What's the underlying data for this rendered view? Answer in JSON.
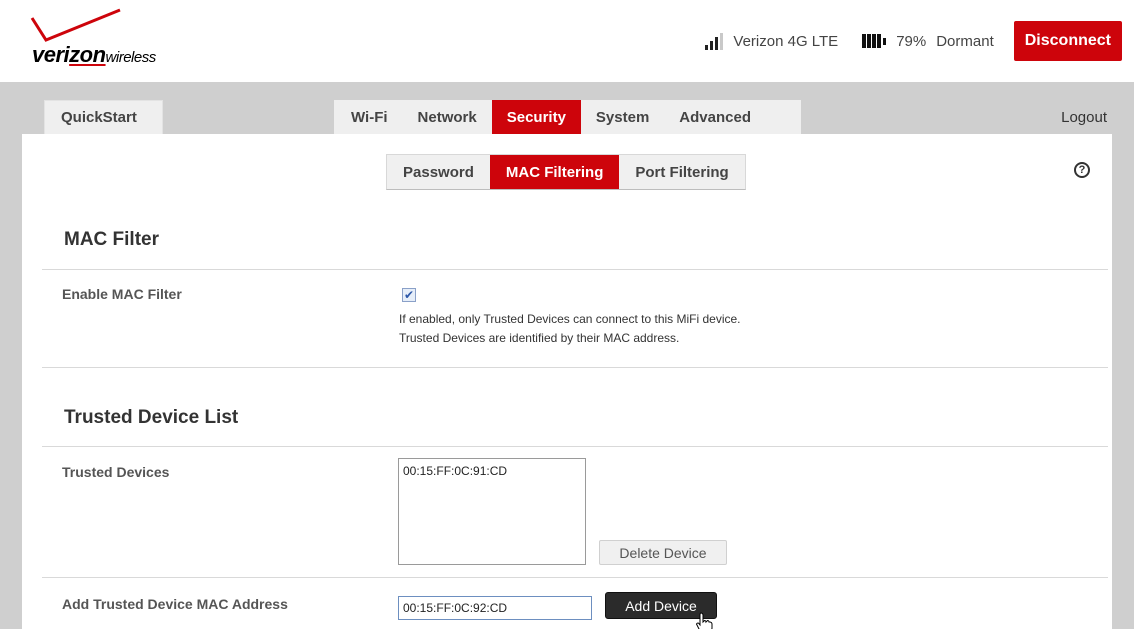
{
  "header": {
    "logo_brand_part1": "veri",
    "logo_brand_part2": "zon",
    "logo_sub": "wireless",
    "carrier": "Verizon 4G LTE",
    "signal_bars": 4,
    "signal_bars_active": 3,
    "battery_percent": "79%",
    "state": "Dormant",
    "disconnect_label": "Disconnect"
  },
  "nav": {
    "quickstart_label": "QuickStart",
    "tabs": [
      "Wi-Fi",
      "Network",
      "Security",
      "System",
      "Advanced"
    ],
    "active_tab": "Security",
    "logout_label": "Logout"
  },
  "subnav": {
    "tabs": [
      "Password",
      "MAC Filtering",
      "Port Filtering"
    ],
    "active_tab": "MAC Filtering"
  },
  "mac_filter": {
    "title": "MAC Filter",
    "enable_label": "Enable MAC Filter",
    "enabled": true,
    "help_line1": "If enabled, only Trusted Devices can connect to this MiFi device.",
    "help_line2": "Trusted Devices are identified by their MAC address."
  },
  "trusted": {
    "title": "Trusted Device List",
    "devices_label": "Trusted Devices",
    "devices": [
      "00:15:FF:0C:91:CD"
    ],
    "delete_label": "Delete Device",
    "add_label": "Add Trusted Device MAC Address",
    "add_value": "00:15:FF:0C:92:CD",
    "add_button": "Add Device"
  },
  "colors": {
    "accent": "#cd040b",
    "band": "#cfcfcf"
  },
  "icons": {
    "help": "help-circle-icon",
    "signal": "signal-bars-icon",
    "battery": "battery-icon",
    "cursor": "hand-pointer-icon"
  }
}
